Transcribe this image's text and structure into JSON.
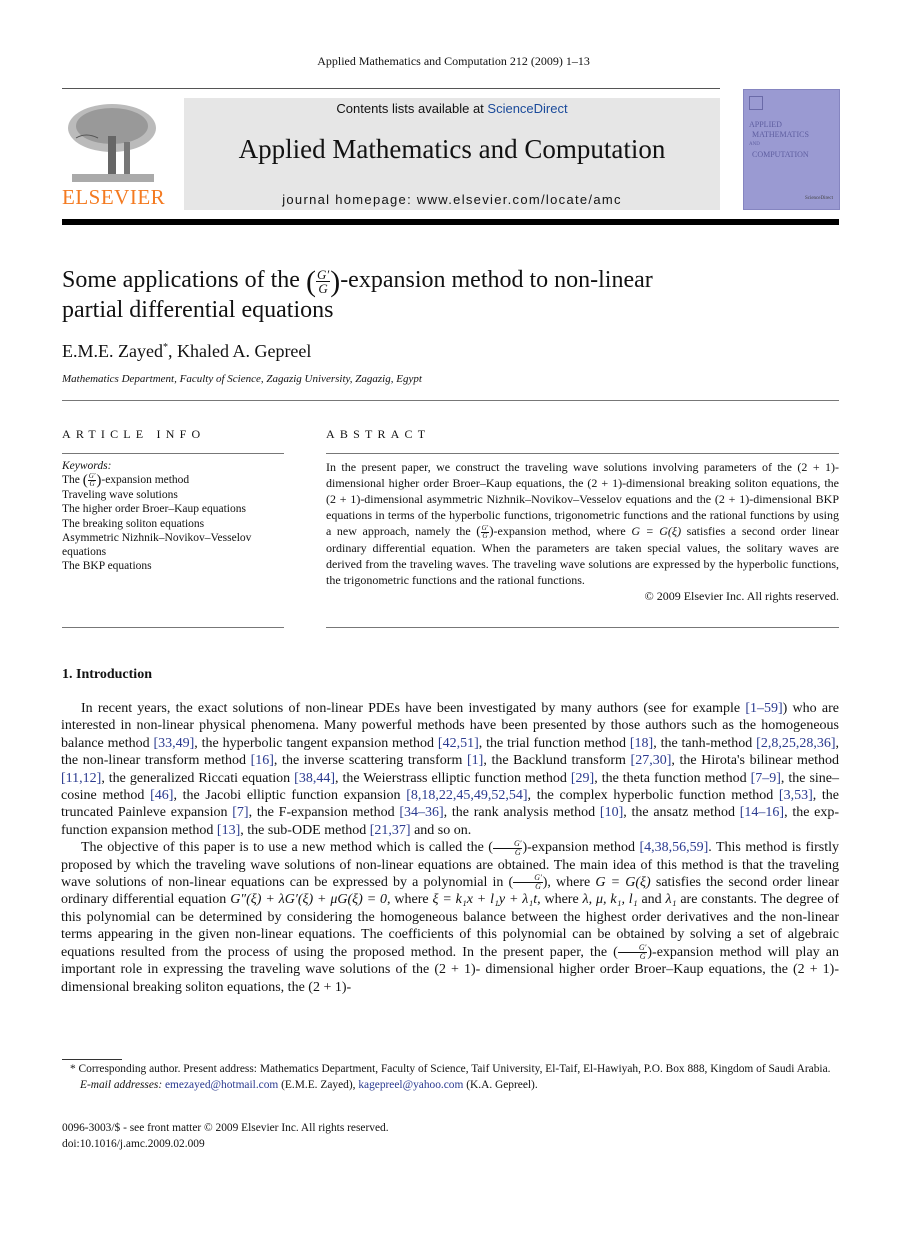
{
  "header": {
    "running_head": "Applied Mathematics and Computation 212 (2009) 1–13",
    "contents_prefix": "Contents lists available at ",
    "contents_link": "ScienceDirect",
    "journal_title": "Applied Mathematics and Computation",
    "homepage": "journal homepage: www.elsevier.com/locate/amc",
    "publisher_logo_text": "ELSEVIER",
    "cover_lines": [
      "APPLIED",
      "MATHEMATICS",
      "AND",
      "COMPUTATION"
    ],
    "cover_brand": "ScienceDirect",
    "colors": {
      "publisher_orange": "#f47a20",
      "link_blue": "#2a3a8f",
      "cover_purple": "#9a9ad2",
      "banner_gray": "#e6e6e6"
    }
  },
  "article": {
    "title_prefix": "Some applications of the ",
    "title_frac_num": "G′",
    "title_frac_den": "G",
    "title_suffix_line1": "-expansion method to non-linear",
    "title_line2": "partial differential equations",
    "author1": "E.M.E. Zayed",
    "author1_mark": "*",
    "author_sep": ", ",
    "author2": "Khaled A. Gepreel",
    "affiliation": "Mathematics Department, Faculty of Science, Zagazig University, Zagazig, Egypt"
  },
  "article_info": {
    "heading": "ARTICLE INFO",
    "keywords_label": "Keywords:",
    "kw1_prefix": "The ",
    "kw1_suffix": "-expansion method",
    "keywords": [
      "Traveling wave solutions",
      "The higher order Broer–Kaup equations",
      "The breaking soliton equations",
      "Asymmetric Nizhnik–Novikov–Vesselov equations",
      "The BKP equations"
    ]
  },
  "abstract": {
    "heading": "ABSTRACT",
    "text_part1": "In the present paper, we construct the traveling wave solutions involving parameters of the (2 + 1)-dimensional higher order Broer–Kaup equations, the (2 + 1)-dimensional breaking soliton equations, the (2 + 1)-dimensional asymmetric Nizhnik–Novikov–Vesselov equations and the (2 + 1)-dimensional BKP equations in terms of the hyperbolic functions, trigonometric functions and the rational functions by using a new approach, namely the ",
    "text_part2": "-expansion method, where ",
    "text_math": "G = G(ξ)",
    "text_part3": " satisfies a second order linear ordinary differential equation. When the parameters are taken special values, the solitary waves are derived from the traveling waves. The traveling wave solutions are expressed by the hyperbolic functions, the trigonometric functions and the rational functions.",
    "copyright": "© 2009 Elsevier Inc. All rights reserved."
  },
  "introduction": {
    "heading": "1.  Introduction",
    "p1_segments": [
      {
        "t": "In recent years, the exact solutions of non-linear PDEs have been investigated by many authors (see for example "
      },
      {
        "ref": "[1–59]"
      },
      {
        "t": ") who are interested in non-linear physical phenomena. Many powerful methods have been presented by those authors such as the homogeneous balance method "
      },
      {
        "ref": "[33,49]"
      },
      {
        "t": ", the hyperbolic tangent expansion method "
      },
      {
        "ref": "[42,51]"
      },
      {
        "t": ", the trial function method "
      },
      {
        "ref": "[18]"
      },
      {
        "t": ", the tanh-method "
      },
      {
        "ref": "[2,8,25,28,36]"
      },
      {
        "t": ", the non-linear transform method "
      },
      {
        "ref": "[16]"
      },
      {
        "t": ", the inverse scattering transform "
      },
      {
        "ref": "[1]"
      },
      {
        "t": ", the Backlund transform "
      },
      {
        "ref": "[27,30]"
      },
      {
        "t": ", the Hirota's bilinear method "
      },
      {
        "ref": "[11,12]"
      },
      {
        "t": ", the generalized Riccati equation "
      },
      {
        "ref": "[38,44]"
      },
      {
        "t": ", the Weierstrass elliptic function method "
      },
      {
        "ref": "[29]"
      },
      {
        "t": ", the theta function method "
      },
      {
        "ref": "[7–9]"
      },
      {
        "t": ", the sine–cosine method "
      },
      {
        "ref": "[46]"
      },
      {
        "t": ", the Jacobi elliptic function expansion "
      },
      {
        "ref": "[8,18,22,45,49,52,54]"
      },
      {
        "t": ", the complex hyperbolic function method "
      },
      {
        "ref": "[3,53]"
      },
      {
        "t": ", the truncated Painleve expansion "
      },
      {
        "ref": "[7]"
      },
      {
        "t": ", the F-expansion method "
      },
      {
        "ref": "[34–36]"
      },
      {
        "t": ", the rank analysis method "
      },
      {
        "ref": "[10]"
      },
      {
        "t": ", the ansatz method "
      },
      {
        "ref": "[14–16]"
      },
      {
        "t": ", the exp-function expansion method "
      },
      {
        "ref": "[13]"
      },
      {
        "t": ", the sub-ODE method "
      },
      {
        "ref": "[21,37]"
      },
      {
        "t": " and so on."
      }
    ],
    "p2_segments": [
      {
        "t": "The objective of this paper is to use a new method which is called the "
      },
      {
        "frac": true
      },
      {
        "t": "-expansion method "
      },
      {
        "ref": "[4,38,56,59]"
      },
      {
        "t": ". This method is firstly proposed by which the traveling wave solutions of non-linear equations are obtained. The main idea of this method is that the traveling wave solutions of non-linear equations can be expressed by a polynomial in "
      },
      {
        "frac": true
      },
      {
        "t": ", where "
      },
      {
        "m": "G = G(ξ)"
      },
      {
        "t": " satisfies the second order linear ordinary differential equation "
      },
      {
        "m": "G″(ξ) + λG′(ξ) + μG(ξ) = 0"
      },
      {
        "t": ", where "
      },
      {
        "m": "ξ = k₁x + l₁y + λ₁t"
      },
      {
        "t": ", where "
      },
      {
        "m": "λ, μ, k₁, l₁"
      },
      {
        "t": " and "
      },
      {
        "m": "λ₁"
      },
      {
        "t": " are constants. The degree of this polynomial can be determined by considering the homogeneous balance between the highest order derivatives and the non-linear terms appearing in the given non-linear equations. The coefficients of this polynomial can be obtained by solving a set of algebraic equations resulted from the process of using the proposed method. In the present paper, the "
      },
      {
        "frac": true
      },
      {
        "t": "-expansion method will play an important role in expressing the traveling wave solutions of the (2 + 1)- dimensional higher order Broer–Kaup equations, the (2 + 1)-dimensional breaking soliton equations, the (2 + 1)-"
      }
    ]
  },
  "footnotes": {
    "corresponding": "* Corresponding author. Present address: Mathematics Department, Faculty of Science, Taif University, El-Taif, El-Hawiyah, P.O. Box 888, Kingdom of Saudi Arabia.",
    "email_label": "E-mail addresses: ",
    "email1": "emezayed@hotmail.com",
    "email1_owner": " (E.M.E. Zayed), ",
    "email2": "kagepreel@yahoo.com",
    "email2_owner": " (K.A. Gepreel).",
    "issn_line": "0096-3003/$ - see front matter © 2009 Elsevier Inc. All rights reserved.",
    "doi": "doi:10.1016/j.amc.2009.02.009"
  }
}
